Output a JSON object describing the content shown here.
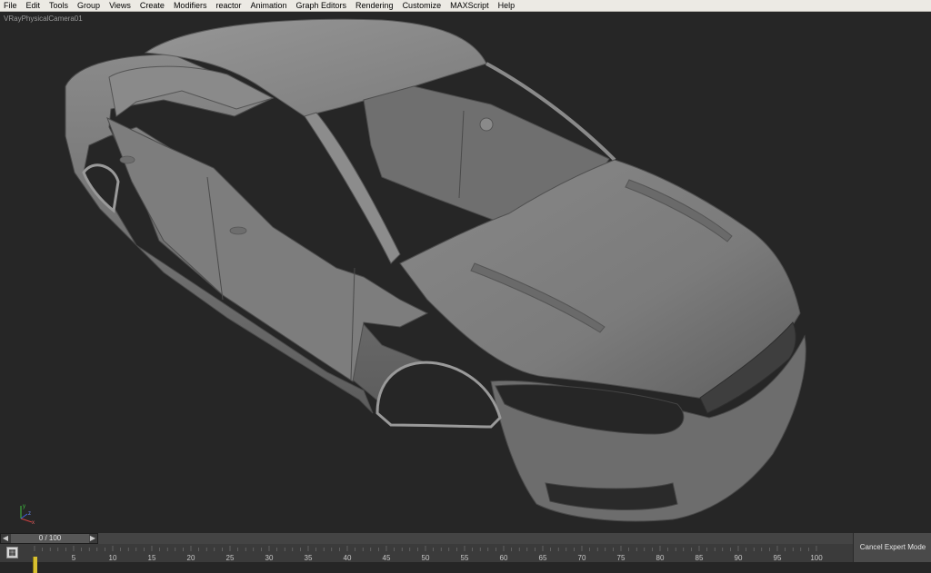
{
  "menubar": {
    "items": [
      "File",
      "Edit",
      "Tools",
      "Group",
      "Views",
      "Create",
      "Modifiers",
      "reactor",
      "Animation",
      "Graph Editors",
      "Rendering",
      "Customize",
      "MAXScript",
      "Help"
    ]
  },
  "viewport": {
    "label": "VRayPhysicalCamera01",
    "background": "#262626",
    "axis": {
      "x": "x",
      "y": "y",
      "z": "z"
    }
  },
  "timeline": {
    "slider_value": "0 / 100",
    "prev_icon": "arrow-left-icon",
    "next_icon": "arrow-right-icon",
    "key_filter_icon": "key-filter-icon",
    "ticks": [
      "5",
      "10",
      "15",
      "20",
      "25",
      "30",
      "35",
      "40",
      "45",
      "50",
      "55",
      "60",
      "65",
      "70",
      "75",
      "80",
      "85",
      "90",
      "95",
      "100"
    ],
    "cursor_color": "#d8c030"
  },
  "status": {
    "expert_mode_button": "Cancel Expert Mode"
  }
}
